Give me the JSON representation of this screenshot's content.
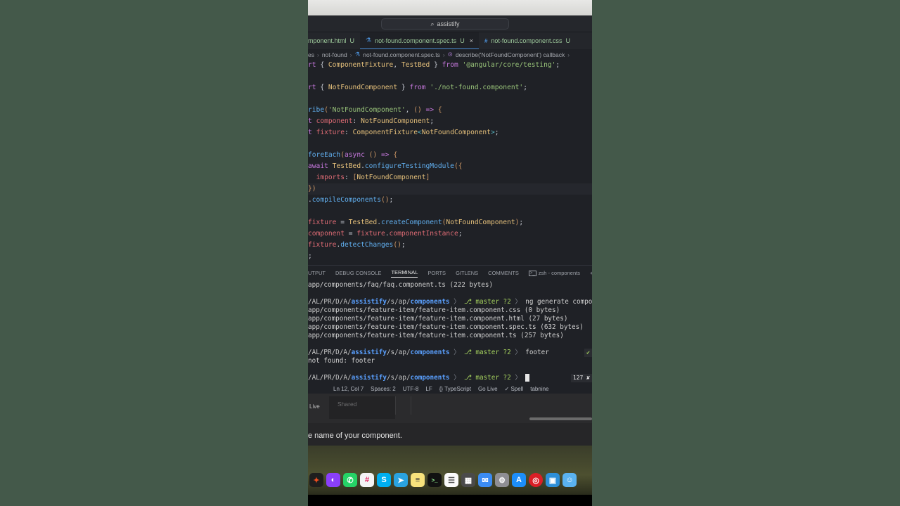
{
  "titlebar": {
    "search_text": "assistify"
  },
  "tabs": [
    {
      "label": "mponent.html",
      "mod": "U"
    },
    {
      "label": "not-found.component.spec.ts",
      "mod": "U",
      "close": "×"
    },
    {
      "label": "not-found.component.css",
      "mod": "U"
    }
  ],
  "breadcrumb": [
    "es",
    "not-found",
    "not-found.component.spec.ts",
    "describe('NotFoundComponent') callback"
  ],
  "panel_tabs": [
    "UTPUT",
    "DEBUG CONSOLE",
    "TERMINAL",
    "PORTS",
    "GITLENS",
    "COMMENTS",
    "zsh - components"
  ],
  "terminal": {
    "line1": "app/components/faq/faq.component.ts (222 bytes)",
    "prompt_path_prefix": "/AL/PR/D/A/",
    "prompt_repo": "assistify",
    "prompt_mid": "/s/ap/",
    "prompt_dir": "components",
    "branch": "master ?2",
    "cmd1": "ng generate component",
    "created": [
      "app/components/feature-item/feature-item.component.css (0 bytes)",
      "app/components/feature-item/feature-item.component.html (27 bytes)",
      "app/components/feature-item/feature-item.component.spec.ts (632 bytes)",
      "app/components/feature-item/feature-item.component.ts (257 bytes)"
    ],
    "cmd2": "footer",
    "status_ok": "✔",
    "error_line": "not found: footer",
    "status_err": "127 ✘"
  },
  "statusbar": [
    "Ln 12, Col 7",
    "Spaces: 2",
    "UTF-8",
    "LF",
    "{} TypeScript",
    "Go Live",
    "✓ Spell",
    "tabnine"
  ],
  "lower": {
    "live": "Live",
    "shared": "Shared"
  },
  "caption": "e name of your component.",
  "dock_icons": [
    "figma-icon",
    "messenger-icon",
    "whatsapp-icon",
    "slack-icon",
    "skype-icon",
    "telegram-icon",
    "notes-icon",
    "terminal-icon",
    "reminders-icon",
    "calculator-icon",
    "mail-icon",
    "settings-icon",
    "app-store-icon",
    "creative-cloud-icon",
    "preview-icon",
    "finder-icon"
  ]
}
